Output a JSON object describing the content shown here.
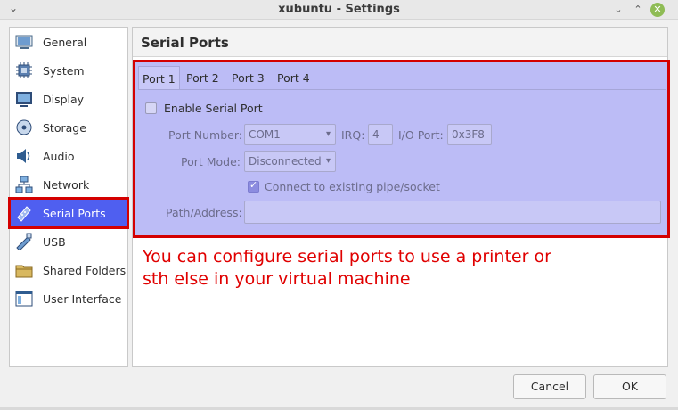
{
  "window": {
    "title": "xubuntu - Settings",
    "menu_icon": "chevron-down-icon",
    "minimize_glyph": "⌄",
    "maximize_glyph": "⌃",
    "close_glyph": "✕"
  },
  "sidebar": {
    "items": [
      {
        "label": "General",
        "icon": "general-icon"
      },
      {
        "label": "System",
        "icon": "system-icon"
      },
      {
        "label": "Display",
        "icon": "display-icon"
      },
      {
        "label": "Storage",
        "icon": "storage-icon"
      },
      {
        "label": "Audio",
        "icon": "audio-icon"
      },
      {
        "label": "Network",
        "icon": "network-icon"
      },
      {
        "label": "Serial Ports",
        "icon": "serial-ports-icon",
        "selected": true
      },
      {
        "label": "USB",
        "icon": "usb-icon"
      },
      {
        "label": "Shared Folders",
        "icon": "shared-folders-icon"
      },
      {
        "label": "User Interface",
        "icon": "user-interface-icon"
      }
    ]
  },
  "page": {
    "title": "Serial Ports",
    "tabs": [
      {
        "label": "Port 1",
        "active": true
      },
      {
        "label": "Port 2"
      },
      {
        "label": "Port 3"
      },
      {
        "label": "Port 4"
      }
    ],
    "enable_serial_port": {
      "label": "Enable Serial Port",
      "checked": false
    },
    "port_number": {
      "label": "Port Number:",
      "value": "COM1"
    },
    "irq": {
      "label": "IRQ:",
      "value": "4"
    },
    "io_port": {
      "label": "I/O Port:",
      "value": "0x3F8"
    },
    "port_mode": {
      "label": "Port Mode:",
      "value": "Disconnected"
    },
    "connect_existing": {
      "label": "Connect to existing pipe/socket",
      "checked": true
    },
    "path_address": {
      "label": "Path/Address:",
      "value": ""
    }
  },
  "annotation": {
    "line1": "You can configure serial ports to use a printer or",
    "line2": "sth else in your virtual machine"
  },
  "buttons": {
    "cancel": "Cancel",
    "ok": "OK"
  },
  "colors": {
    "accent": "#4f5ff0",
    "highlight_red": "#d40000",
    "annotation_red": "#e00000",
    "overlay": "#bcbcf6"
  }
}
